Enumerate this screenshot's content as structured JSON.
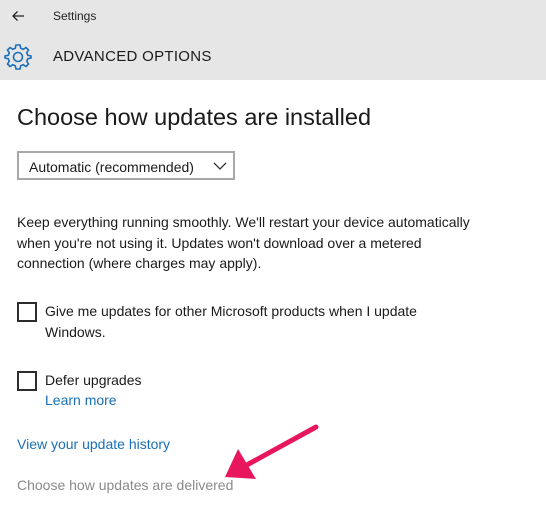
{
  "titlebar": {
    "back_icon": "back-arrow-icon",
    "title": "Settings"
  },
  "header": {
    "icon": "gear-icon",
    "title": "ADVANCED OPTIONS"
  },
  "main": {
    "heading": "Choose how updates are installed",
    "install_mode": {
      "selected": "Automatic (recommended)",
      "chevron_icon": "chevron-down-icon"
    },
    "description": "Keep everything running smoothly. We'll restart your device automatically when you're not using it. Updates won't download over a metered connection (where charges may apply).",
    "options": [
      {
        "label": "Give me updates for other Microsoft products when I update Windows.",
        "checked": false
      },
      {
        "label": "Defer upgrades",
        "checked": false,
        "link": "Learn more"
      }
    ],
    "history_link": "View your update history",
    "delivery_link": "Choose how updates are delivered"
  },
  "colors": {
    "accent": "#1a6fb8",
    "annotation_arrow": "#e8175d",
    "header_bg": "#e6e6e6",
    "muted_text": "#8a8a8a"
  }
}
